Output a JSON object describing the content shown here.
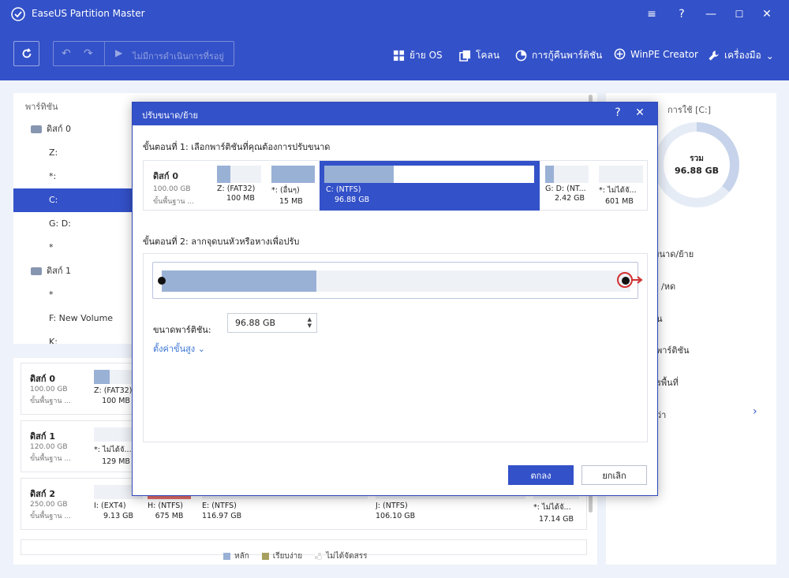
{
  "app": {
    "title": "EaseUS Partition Master"
  },
  "toolbar": {
    "pending_label": "ไม่มีการดำเนินการที่รอยู่",
    "migrate_os": "ย้าย OS",
    "clone": "โคลน",
    "partition_recovery": "การกู้คืนพาร์ติชัน",
    "winpe": "WinPE Creator",
    "tools": "เครื่องมือ"
  },
  "left": {
    "header": "พาร์ทิชัน",
    "tree": [
      {
        "label": "ดิสก์ 0",
        "kind": "disk"
      },
      {
        "label": "Z:",
        "kind": "part"
      },
      {
        "label": "*:",
        "kind": "part"
      },
      {
        "label": "C:",
        "kind": "part",
        "selected": true
      },
      {
        "label": "G: D:",
        "kind": "part"
      },
      {
        "label": "*",
        "kind": "part"
      },
      {
        "label": "ดิสก์ 1",
        "kind": "disk"
      },
      {
        "label": "*",
        "kind": "part"
      },
      {
        "label": "F: New Volume",
        "kind": "part"
      },
      {
        "label": "K:",
        "kind": "part"
      }
    ]
  },
  "diskmap": {
    "disks": [
      {
        "name": "ดิสก์ 0",
        "size": "100.00 GB",
        "type": "ขั้นพื้นฐาน ...",
        "parts": [
          {
            "name": "Z: (FAT32)",
            "size": "100 MB",
            "used": 0.35
          }
        ]
      },
      {
        "name": "ดิสก์ 1",
        "size": "120.00 GB",
        "type": "ขั้นพื้นฐาน ...",
        "parts": [
          {
            "name": "*: ไม่ได้จั...",
            "size": "129 MB"
          }
        ]
      },
      {
        "name": "ดิสก์ 2",
        "size": "250.00 GB",
        "type": "ขั้นพื้นฐาน ...",
        "parts": [
          {
            "name": "I: (EXT4)",
            "size": "9.13 GB"
          },
          {
            "name": "H: (NTFS)",
            "size": "675 MB",
            "color": "#e06c6c"
          },
          {
            "name": "E: (NTFS)",
            "size": "116.97 GB"
          },
          {
            "name": "J: (NTFS)",
            "size": "106.10 GB"
          },
          {
            "name": "*: ไม่ได้จั...",
            "size": "17.14 GB"
          }
        ]
      }
    ]
  },
  "legend": {
    "primary": "หลัก",
    "simple": "เรียบง่าย",
    "unallocated": "ไม่ได้จัดสรร"
  },
  "right": {
    "title": "การใช้ [C:]",
    "total_label": "รวม",
    "total_value": "96.88 GB",
    "used_fraction": 0.36,
    "items": [
      "ขนาด/ย้าย",
      "/หด",
      "น",
      "พาร์ติชัน",
      "รพื้นที่",
      "ว่า"
    ]
  },
  "dialog": {
    "title": "ปรับขนาด/ย้าย",
    "step1": "ขั้นตอนที่ 1: เลือกพาร์ติชันที่คุณต้องการปรับขนาด",
    "step2": "ขั้นตอนที่ 2: ลากจุดบนหัวหรือหางเพื่อปรับ",
    "disk": {
      "name": "ดิสก์ 0",
      "size": "100.00 GB",
      "type": "ขั้นพื้นฐาน ..."
    },
    "parts": [
      {
        "name": "Z: (FAT32)",
        "size": "100 MB",
        "used": 0.3
      },
      {
        "name": "*: (อื่นๆ)",
        "size": "15 MB",
        "used": 1.0
      },
      {
        "name": "C: (NTFS)",
        "size": "96.88 GB",
        "used": 0.33
      },
      {
        "name": "G: D: (NT...",
        "size": "2.42 GB",
        "used": 0.2
      },
      {
        "name": "*: ไม่ได้จั...",
        "size": "601 MB"
      }
    ],
    "slider_used_fraction": 0.33,
    "size_label": "ขนาดพาร์ติชัน:",
    "size_value": "96.88 GB",
    "advanced": "ตั้งค่าขั้นสูง",
    "ok": "ตกลง",
    "cancel": "ยกเลิก"
  },
  "colors": {
    "accent": "#3351c8",
    "primary_part": "#9ab1d6",
    "simple_part": "#a8a060",
    "danger": "#d03030"
  }
}
